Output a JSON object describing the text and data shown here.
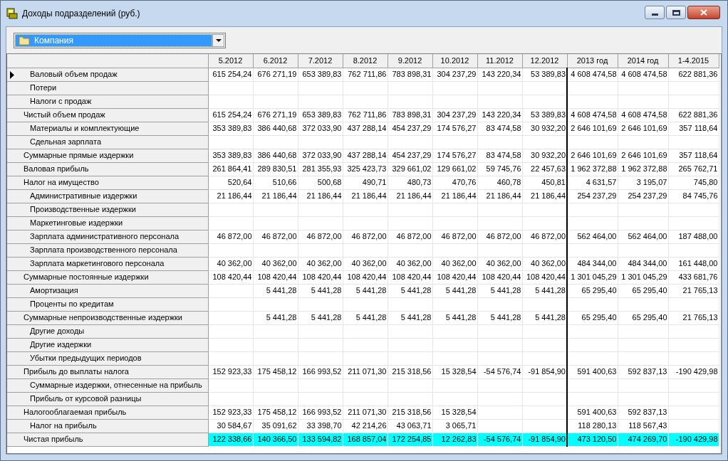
{
  "window": {
    "title": "Доходы подразделений (руб.)"
  },
  "selector": {
    "value": "Компания"
  },
  "table": {
    "columns": [
      {
        "label": "5.2012",
        "kind": "month"
      },
      {
        "label": "6.2012",
        "kind": "month"
      },
      {
        "label": "7.2012",
        "kind": "month"
      },
      {
        "label": "8.2012",
        "kind": "month"
      },
      {
        "label": "9.2012",
        "kind": "month"
      },
      {
        "label": "10.2012",
        "kind": "month"
      },
      {
        "label": "11.2012",
        "kind": "month"
      },
      {
        "label": "12.2012",
        "kind": "month"
      },
      {
        "label": "2013 год",
        "kind": "year"
      },
      {
        "label": "2014 год",
        "kind": "year"
      },
      {
        "label": "1-4.2015",
        "kind": "year"
      }
    ],
    "rows": [
      {
        "label": "Валовый объем продаж",
        "kind": "item",
        "selected": true,
        "cells": [
          "615 254,24",
          "676 271,19",
          "653 389,83",
          "762 711,86",
          "783 898,31",
          "304 237,29",
          "143 220,34",
          "53 389,83",
          "4 608 474,58",
          "4 608 474,58",
          "622 881,36"
        ]
      },
      {
        "label": "Потери",
        "kind": "item",
        "selected": false,
        "cells": [
          null,
          null,
          null,
          null,
          null,
          null,
          null,
          null,
          null,
          null,
          null
        ]
      },
      {
        "label": "Налоги с продаж",
        "kind": "item",
        "selected": false,
        "cells": [
          null,
          null,
          null,
          null,
          null,
          null,
          null,
          null,
          null,
          null,
          null
        ]
      },
      {
        "label": "Чистый объем продаж",
        "kind": "total",
        "selected": false,
        "cells": [
          "615 254,24",
          "676 271,19",
          "653 389,83",
          "762 711,86",
          "783 898,31",
          "304 237,29",
          "143 220,34",
          "53 389,83",
          "4 608 474,58",
          "4 608 474,58",
          "622 881,36"
        ]
      },
      {
        "label": "Материалы и комплектующие",
        "kind": "item",
        "selected": false,
        "cells": [
          "353 389,83",
          "386 440,68",
          "372 033,90",
          "437 288,14",
          "454 237,29",
          "174 576,27",
          "83 474,58",
          "30 932,20",
          "2 646 101,69",
          "2 646 101,69",
          "357 118,64"
        ]
      },
      {
        "label": "Сдельная зарплата",
        "kind": "item",
        "selected": false,
        "cells": [
          null,
          null,
          null,
          null,
          null,
          null,
          null,
          null,
          null,
          null,
          null
        ]
      },
      {
        "label": "Суммарные прямые издержки",
        "kind": "total",
        "selected": false,
        "cells": [
          "353 389,83",
          "386 440,68",
          "372 033,90",
          "437 288,14",
          "454 237,29",
          "174 576,27",
          "83 474,58",
          "30 932,20",
          "2 646 101,69",
          "2 646 101,69",
          "357 118,64"
        ]
      },
      {
        "label": "Валовая прибыль",
        "kind": "total",
        "selected": false,
        "cells": [
          "261 864,41",
          "289 830,51",
          "281 355,93",
          "325 423,73",
          "329 661,02",
          "129 661,02",
          "59 745,76",
          "22 457,63",
          "1 962 372,88",
          "1 962 372,88",
          "265 762,71"
        ]
      },
      {
        "label": "Налог на имущество",
        "kind": "total",
        "selected": false,
        "cells": [
          "520,64",
          "510,66",
          "500,68",
          "490,71",
          "480,73",
          "470,76",
          "460,78",
          "450,81",
          "4 631,57",
          "3 195,07",
          "745,80"
        ]
      },
      {
        "label": "Административные издержки",
        "kind": "item",
        "selected": false,
        "cells": [
          "21 186,44",
          "21 186,44",
          "21 186,44",
          "21 186,44",
          "21 186,44",
          "21 186,44",
          "21 186,44",
          "21 186,44",
          "254 237,29",
          "254 237,29",
          "84 745,76"
        ]
      },
      {
        "label": "Производственные издержки",
        "kind": "item",
        "selected": false,
        "cells": [
          null,
          null,
          null,
          null,
          null,
          null,
          null,
          null,
          null,
          null,
          null
        ]
      },
      {
        "label": "Маркетинговые издержки",
        "kind": "item",
        "selected": false,
        "cells": [
          null,
          null,
          null,
          null,
          null,
          null,
          null,
          null,
          null,
          null,
          null
        ]
      },
      {
        "label": "Зарплата административного персонала",
        "kind": "item",
        "selected": false,
        "cells": [
          "46 872,00",
          "46 872,00",
          "46 872,00",
          "46 872,00",
          "46 872,00",
          "46 872,00",
          "46 872,00",
          "46 872,00",
          "562 464,00",
          "562 464,00",
          "187 488,00"
        ]
      },
      {
        "label": "Зарплата производственного персонала",
        "kind": "item",
        "selected": false,
        "cells": [
          null,
          null,
          null,
          null,
          null,
          null,
          null,
          null,
          null,
          null,
          null
        ]
      },
      {
        "label": "Зарплата маркетингового персонала",
        "kind": "item",
        "selected": false,
        "cells": [
          "40 362,00",
          "40 362,00",
          "40 362,00",
          "40 362,00",
          "40 362,00",
          "40 362,00",
          "40 362,00",
          "40 362,00",
          "484 344,00",
          "484 344,00",
          "161 448,00"
        ]
      },
      {
        "label": "Суммарные постоянные издержки",
        "kind": "total",
        "selected": false,
        "cells": [
          "108 420,44",
          "108 420,44",
          "108 420,44",
          "108 420,44",
          "108 420,44",
          "108 420,44",
          "108 420,44",
          "108 420,44",
          "1 301 045,29",
          "1 301 045,29",
          "433 681,76"
        ]
      },
      {
        "label": "Амортизация",
        "kind": "item",
        "selected": false,
        "cells": [
          null,
          "5 441,28",
          "5 441,28",
          "5 441,28",
          "5 441,28",
          "5 441,28",
          "5 441,28",
          "5 441,28",
          "65 295,40",
          "65 295,40",
          "21 765,13"
        ]
      },
      {
        "label": "Проценты по кредитам",
        "kind": "item",
        "selected": false,
        "cells": [
          null,
          null,
          null,
          null,
          null,
          null,
          null,
          null,
          null,
          null,
          null
        ]
      },
      {
        "label": "Суммарные непроизводственные издержки",
        "kind": "total",
        "selected": false,
        "cells": [
          null,
          "5 441,28",
          "5 441,28",
          "5 441,28",
          "5 441,28",
          "5 441,28",
          "5 441,28",
          "5 441,28",
          "65 295,40",
          "65 295,40",
          "21 765,13"
        ]
      },
      {
        "label": "Другие доходы",
        "kind": "item",
        "selected": false,
        "cells": [
          null,
          null,
          null,
          null,
          null,
          null,
          null,
          null,
          null,
          null,
          null
        ]
      },
      {
        "label": "Другие издержки",
        "kind": "item",
        "selected": false,
        "cells": [
          null,
          null,
          null,
          null,
          null,
          null,
          null,
          null,
          null,
          null,
          null
        ]
      },
      {
        "label": "Убытки предыдущих периодов",
        "kind": "item",
        "selected": false,
        "cells": [
          null,
          null,
          null,
          null,
          null,
          null,
          null,
          null,
          null,
          null,
          null
        ]
      },
      {
        "label": "Прибыль до выплаты налога",
        "kind": "total",
        "selected": false,
        "cells": [
          "152 923,33",
          "175 458,12",
          "166 993,52",
          "211 071,30",
          "215 318,56",
          "15 328,54",
          "-54 576,74",
          "-91 854,90",
          "591 400,63",
          "592 837,13",
          "-190 429,98"
        ]
      },
      {
        "label": "Суммарные издержки, отнесенные на прибыль",
        "kind": "item",
        "selected": false,
        "cells": [
          null,
          null,
          null,
          null,
          null,
          null,
          null,
          null,
          null,
          null,
          null
        ]
      },
      {
        "label": "Прибыль от курсовой разницы",
        "kind": "item",
        "selected": false,
        "cells": [
          null,
          null,
          null,
          null,
          null,
          null,
          null,
          null,
          null,
          null,
          null
        ]
      },
      {
        "label": "Налогооблагаемая прибыль",
        "kind": "total",
        "selected": false,
        "cells": [
          "152 923,33",
          "175 458,12",
          "166 993,52",
          "211 071,30",
          "215 318,56",
          "15 328,54",
          null,
          null,
          "591 400,63",
          "592 837,13",
          null
        ]
      },
      {
        "label": "Налог на прибыль",
        "kind": "item",
        "selected": false,
        "cells": [
          "30 584,67",
          "35 091,62",
          "33 398,70",
          "42 214,26",
          "43 063,71",
          "3 065,71",
          null,
          null,
          "118 280,13",
          "118 567,43",
          null
        ]
      },
      {
        "label": "Чистая прибыль",
        "kind": "result",
        "selected": false,
        "cells": [
          "122 338,66",
          "140 366,50",
          "133 594,82",
          "168 857,04",
          "172 254,85",
          "12 262,83",
          "-54 576,74",
          "-91 854,90",
          "473 120,50",
          "474 269,70",
          "-190 429,98"
        ]
      }
    ]
  }
}
